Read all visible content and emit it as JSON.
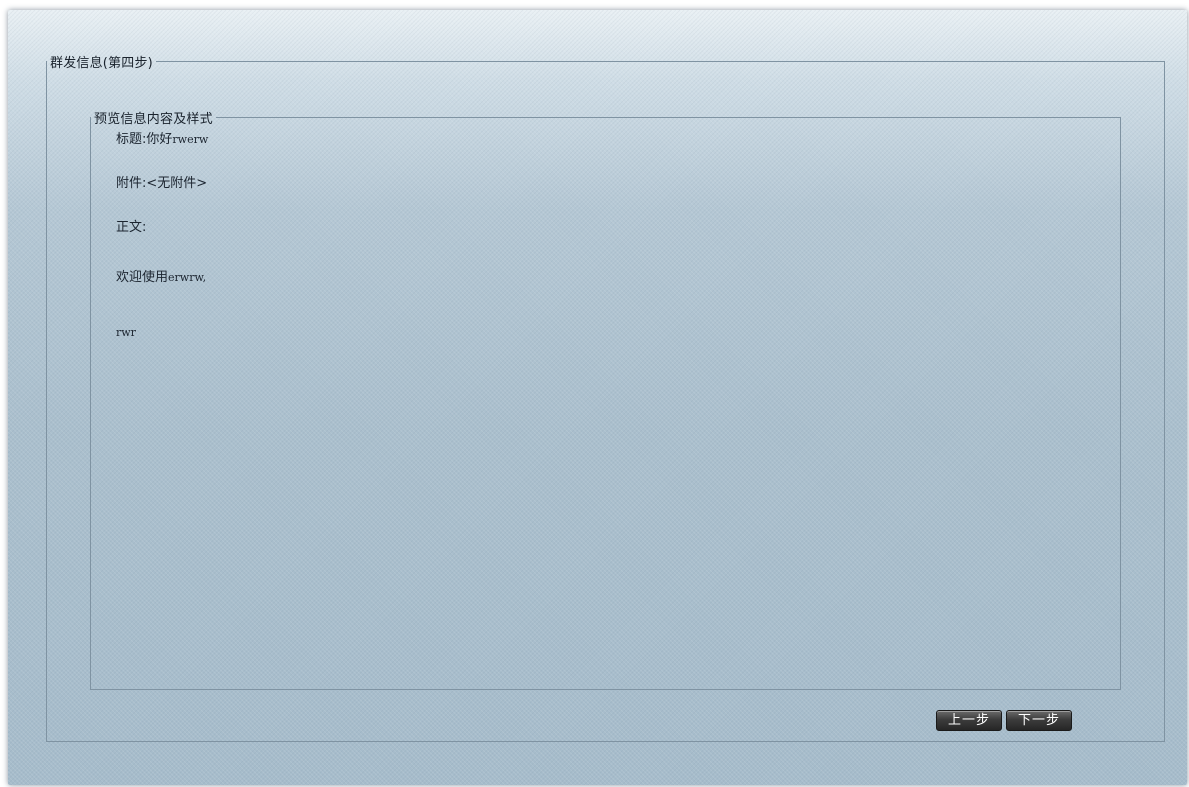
{
  "outer_group": {
    "legend": "群发信息(第四步)"
  },
  "preview_group": {
    "legend": "预览信息内容及样式",
    "subject_label": "标题:",
    "subject_prefix": "你好",
    "subject_value": "rwerw",
    "attachment_label": "附件:",
    "attachment_value": "<无附件>",
    "body_label": "正文:",
    "body_greeting_prefix": "欢迎使用",
    "body_greeting_value": "erwrw,",
    "body_text": "rwr"
  },
  "buttons": {
    "prev_label": "上一步",
    "next_label": "下一步"
  }
}
